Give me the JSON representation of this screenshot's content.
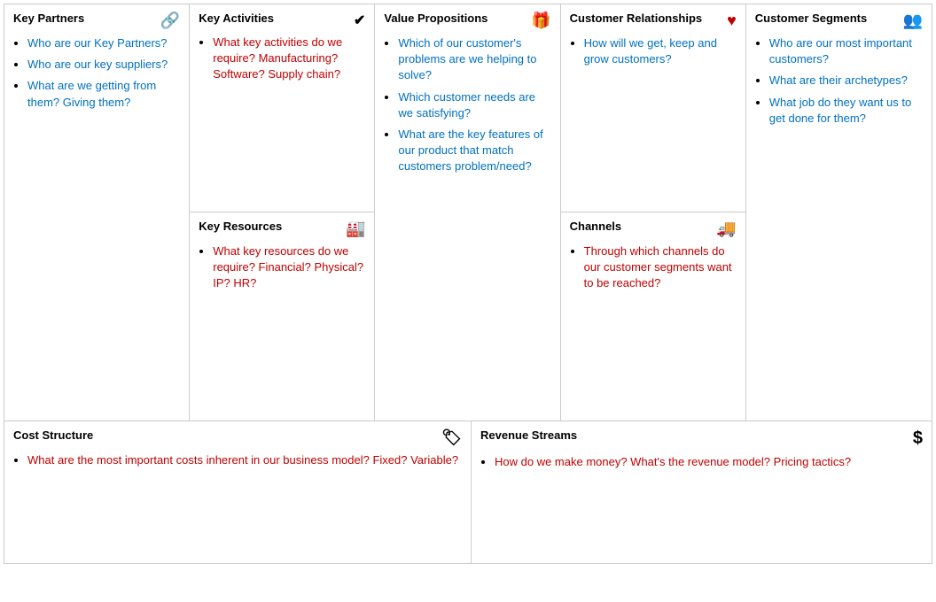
{
  "sections": {
    "key_partners": {
      "title": "Key Partners",
      "icon": "🔗",
      "items": [
        {
          "text": "Who are our Key Partners?",
          "color": "blue"
        },
        {
          "text": "Who are our key suppliers?",
          "color": "blue"
        },
        {
          "text": "What are we getting from them? Giving them?",
          "color": "blue"
        }
      ]
    },
    "key_activities": {
      "title": "Key Activities",
      "icon": "✔",
      "items": [
        {
          "text": "What key activities do we require? Manufacturing? Software? Supply chain?",
          "color": "red"
        }
      ]
    },
    "key_resources": {
      "title": "Key Resources",
      "icon": "🏭",
      "items": [
        {
          "text": "What key resources do we require? Financial? Physical? IP? HR?",
          "color": "red"
        }
      ]
    },
    "value_propositions": {
      "title": "Value Propositions",
      "icon": "🎁",
      "items": [
        {
          "text": "Which of our customer's problems are we helping to solve?",
          "color": "blue"
        },
        {
          "text": "Which customer needs are we satisfying?",
          "color": "blue"
        },
        {
          "text": "What are the key features of our product that match customers problem/need?",
          "color": "blue"
        }
      ]
    },
    "customer_relationships": {
      "title": "Customer Relationships",
      "icon": "♥",
      "items": [
        {
          "text": "How will we get, keep and grow customers?",
          "color": "blue"
        }
      ]
    },
    "channels": {
      "title": "Channels",
      "icon": "🚚",
      "items": [
        {
          "text": "Through which channels do our customer segments want to be reached?",
          "color": "red"
        }
      ]
    },
    "customer_segments": {
      "title": "Customer Segments",
      "icon": "👥",
      "items": [
        {
          "text": "Who are our most important customers?",
          "color": "blue"
        },
        {
          "text": "What are their archetypes?",
          "color": "blue"
        },
        {
          "text": "What job do they want us to get done for them?",
          "color": "blue"
        }
      ]
    },
    "cost_structure": {
      "title": "Cost Structure",
      "icon": "🏷",
      "items": [
        {
          "text": "What are the most important costs inherent in our business model? Fixed? Variable?",
          "color": "red"
        }
      ]
    },
    "revenue_streams": {
      "title": "Revenue Streams",
      "icon": "$",
      "items": [
        {
          "text": "How do we make money? What's the revenue model? Pricing tactics?",
          "color": "red"
        }
      ]
    }
  }
}
